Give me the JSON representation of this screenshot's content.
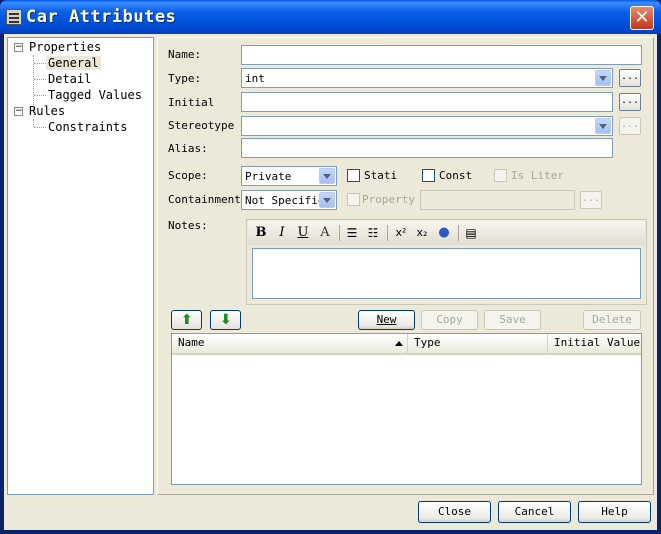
{
  "window": {
    "title": "Car Attributes"
  },
  "tree": {
    "properties": "Properties",
    "general": "General",
    "detail": "Detail",
    "tagged_values": "Tagged Values",
    "rules": "Rules",
    "constraints": "Constraints"
  },
  "form": {
    "name_label": "Name:",
    "name_value": "",
    "type_label": "Type:",
    "type_value": "int",
    "initial_label": "Initial",
    "initial_value": "",
    "stereotype_label": "Stereotype",
    "stereotype_value": "",
    "alias_label": "Alias:",
    "alias_value": "",
    "scope_label": "Scope:",
    "scope_value": "Private",
    "static_label": "Static",
    "const_label": "Const",
    "is_literal_label": "Is Literal",
    "containment_label": "Containment",
    "containment_value": "Not Specified",
    "property_label": "Property",
    "property_value": "",
    "notes_label": "Notes:",
    "notes_value": "",
    "browse": "..."
  },
  "notes_toolbar": {
    "bold": "B",
    "italic": "I",
    "underline": "U",
    "font_color": "A",
    "superscript": "x²",
    "subscript": "x₂"
  },
  "actions": {
    "new": "New",
    "copy": "Copy",
    "save": "Save",
    "delete": "Delete"
  },
  "list": {
    "columns": [
      "Name",
      "Type",
      "Initial Value"
    ]
  },
  "footer": {
    "close": "Close",
    "cancel": "Cancel",
    "help": "Help"
  }
}
